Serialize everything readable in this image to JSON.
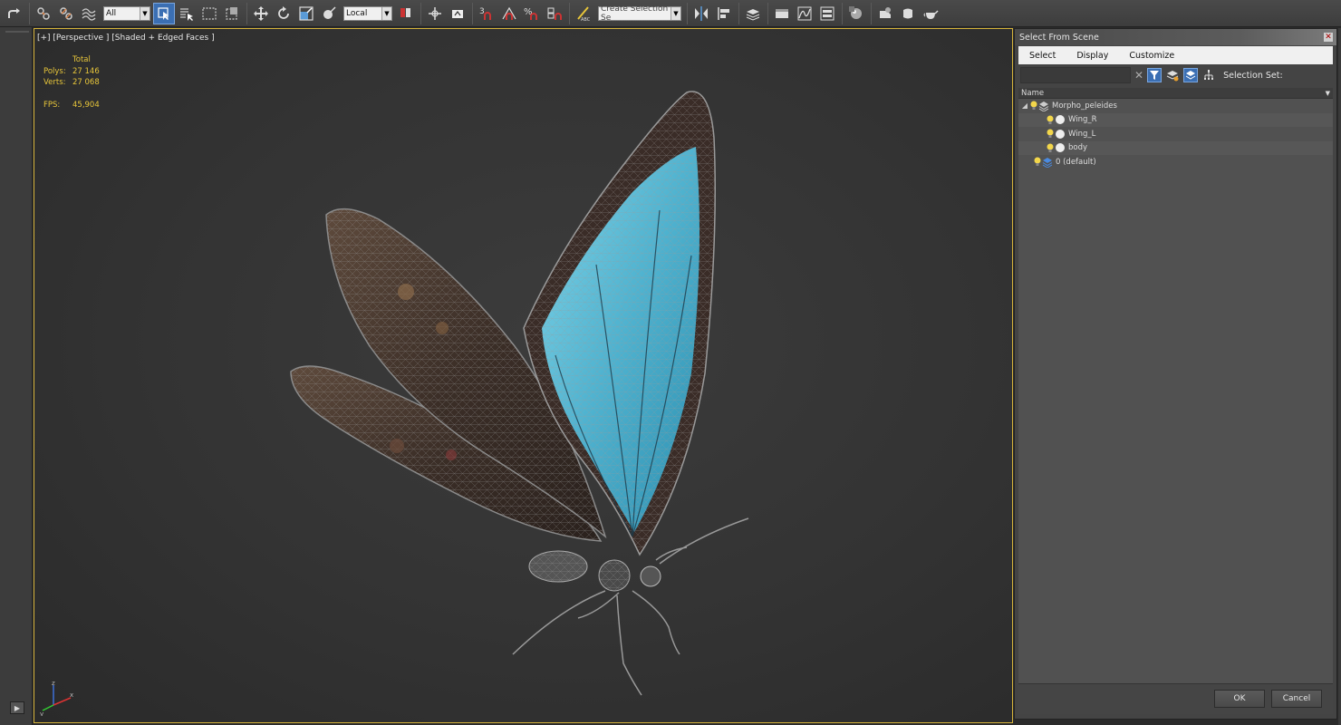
{
  "toolbar": {
    "filter_value": "All",
    "coord_value": "Local",
    "selection_set_placeholder": "Create Selection Se",
    "icons": [
      "redo-icon",
      "link-icon",
      "unlink-icon",
      "bind-spacewarp-icon",
      "select-object-icon",
      "select-by-name-icon",
      "rect-region-icon",
      "window-crossing-icon",
      "move-icon",
      "rotate-icon",
      "scale-icon",
      "select-manipulate-icon",
      "keyboard-shortcut-icon",
      "pivot-icon",
      "snap-3d-icon",
      "angle-snap-icon",
      "percent-snap-icon",
      "spinner-snap-icon",
      "edit-named-sets-icon",
      "mirror-icon",
      "align-icon",
      "layer-explorer-icon",
      "curve-editor-icon",
      "schematic-view-icon",
      "material-editor-icon",
      "render-setup-icon",
      "rendered-frame-icon",
      "render-icon",
      "render-teapot-icon"
    ]
  },
  "viewport": {
    "label": "[+] [Perspective ] [Shaded + Edged Faces ]",
    "stats": {
      "header": "Total",
      "polys_label": "Polys:",
      "polys_value": "27 146",
      "verts_label": "Verts:",
      "verts_value": "27 068",
      "fps_label": "FPS:",
      "fps_value": "45,904"
    },
    "axis": {
      "x": "x",
      "y": "y",
      "z": "z"
    }
  },
  "dialog": {
    "title": "Select From Scene",
    "menu": [
      "Select",
      "Display",
      "Customize"
    ],
    "search_placeholder": "",
    "selection_set_label": "Selection Set:",
    "column_name": "Name",
    "tree": [
      {
        "label": "Morpho_peleides",
        "type": "layer",
        "expanded": true
      },
      {
        "label": "Wing_R",
        "type": "object"
      },
      {
        "label": "Wing_L",
        "type": "object"
      },
      {
        "label": "body",
        "type": "object"
      },
      {
        "label": "0 (default)",
        "type": "layer"
      }
    ],
    "ok_label": "OK",
    "cancel_label": "Cancel"
  },
  "colors": {
    "accent": "#3b6fb3",
    "viewport_border": "#d6b43b",
    "stats_text": "#e8c63a",
    "wing_blue": "#5ab8d2"
  }
}
